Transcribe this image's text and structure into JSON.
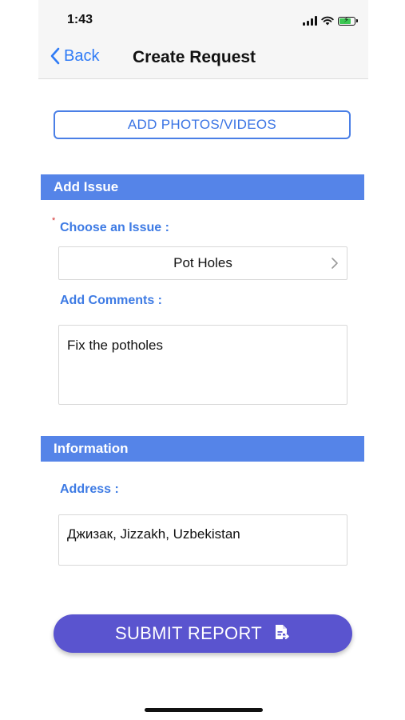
{
  "status_bar": {
    "time": "1:43",
    "icons": [
      "cellular-signal-icon",
      "wifi-icon",
      "battery-charging-icon"
    ],
    "battery_level": 0.8
  },
  "nav": {
    "back_label": "Back",
    "title": "Create Request"
  },
  "media": {
    "add_button_label": "ADD PHOTOS/VIDEOS"
  },
  "issue_section": {
    "header": "Add Issue",
    "required_mark": "*",
    "choose_label": "Choose an Issue :",
    "selected_issue": "Pot Holes",
    "comments_label": "Add Comments :",
    "comments_value": "Fix the potholes"
  },
  "info_section": {
    "header": "Information",
    "address_label": "Address :",
    "address_value": "Джизак, Jizzakh, Uzbekistan"
  },
  "submit": {
    "label": "SUBMIT REPORT",
    "icon": "document-arrow-icon"
  },
  "colors": {
    "accent_blue": "#5584e8",
    "link_blue": "#2f7bf6",
    "submit_purple": "#5a54cf",
    "required_red": "#d32f2f"
  }
}
